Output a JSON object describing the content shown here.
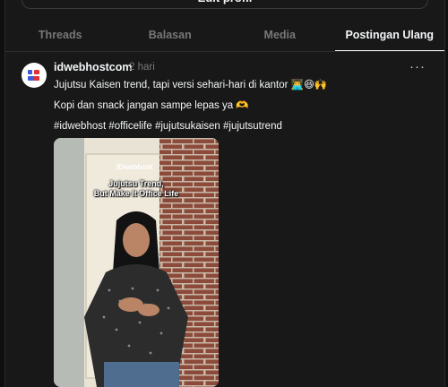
{
  "header": {
    "edit_profile_label": "Edit profil"
  },
  "tabs": [
    {
      "label": "Threads"
    },
    {
      "label": "Balasan"
    },
    {
      "label": "Media"
    },
    {
      "label": "Postingan Ulang",
      "active": true
    }
  ],
  "post": {
    "username": "idwebhostcom",
    "time": "2 hari",
    "line1": "Jujutsu Kaisen trend, tapi versi sehari-hari di kantor 👨‍💻😆🙌",
    "line2": "Kopi dan snack jangan sampe lepas ya 🫶",
    "hashtags": "#idwebhost #officelife #jujutsukaisen #jujutsutrend",
    "more_glyph": "···",
    "media": {
      "watermark": "IDwebhost",
      "caption_line1": "Jujutsu Trend,",
      "caption_line2": "But Make It Office Life"
    }
  },
  "colors": {
    "background": "#181818",
    "text": "#f3f5f7",
    "muted": "#777777"
  }
}
